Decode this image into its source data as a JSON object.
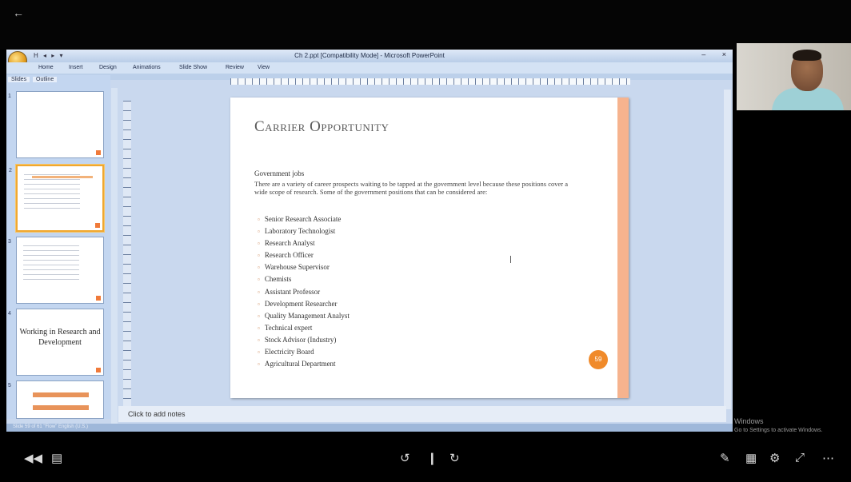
{
  "viewer": {
    "back_icon": "arrow-left-icon"
  },
  "ppt": {
    "window_title": "Ch 2.ppt [Compatibility Mode] - Microsoft PowerPoint",
    "qat": "H ◂ ▸ ▾",
    "window_controls": "– ×",
    "ribbon_tabs": [
      "Home",
      "Insert",
      "Design",
      "Animations",
      "Slide Show",
      "Review",
      "View"
    ],
    "panel_tabs": [
      "Slides",
      "Outline"
    ],
    "thumbnails": [
      {
        "number": "1",
        "text": ""
      },
      {
        "number": "2",
        "text": ""
      },
      {
        "number": "3",
        "text": ""
      },
      {
        "number": "4",
        "text": "Working in Research and Development"
      },
      {
        "number": "5",
        "text": ""
      }
    ],
    "slide": {
      "title": "Carrier Opportunity",
      "subtitle": "Government jobs",
      "paragraph": "There are a variety of career prospects waiting to be tapped at the government level because these positions cover a wide scope of research. Some of the government positions that can be considered are:",
      "items": [
        "Senior Research Associate",
        "Laboratory Technologist",
        "Research Analyst",
        "Research Officer",
        "Warehouse Supervisor",
        "Chemists",
        "Assistant Professor",
        "Development Researcher",
        "Quality Management Analyst",
        "Technical expert",
        "Stock Advisor (Industry)",
        "Electricity Board",
        "Agricultural Department"
      ],
      "badge": "59"
    },
    "notes_placeholder": "Click to add notes",
    "status_text": "Slide 59 of 61   \"Flow\"   English (U.S.)"
  },
  "watermark": {
    "line1": "Windows",
    "line2": "Go to Settings to activate Windows."
  }
}
